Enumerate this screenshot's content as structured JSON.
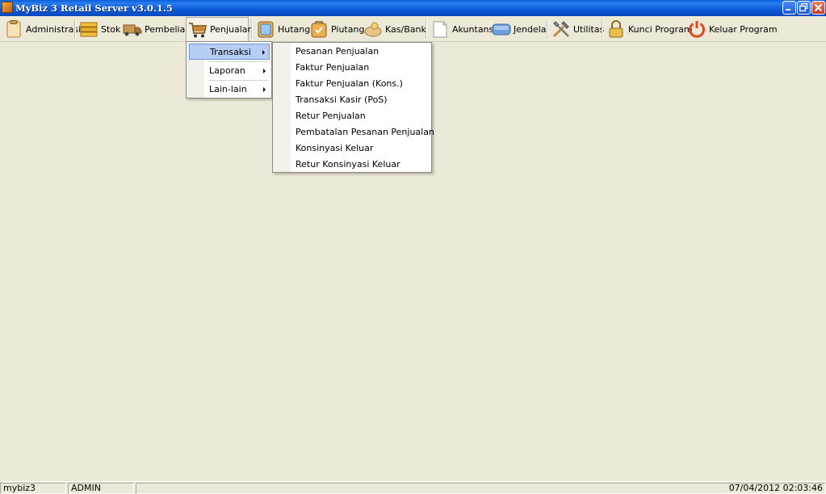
{
  "window": {
    "title": "MyBiz 3 Retail Server v3.0.1.5"
  },
  "menubar": {
    "items": [
      {
        "label": "Administrasi",
        "icon": "clipboard-icon"
      },
      {
        "label": "Stok",
        "icon": "stock-boxes-icon"
      },
      {
        "label": "Pembelian",
        "icon": "truck-icon"
      },
      {
        "label": "Penjualan",
        "icon": "shopping-cart-icon"
      },
      {
        "label": "Hutang",
        "icon": "ledger-icon"
      },
      {
        "label": "Piutang",
        "icon": "bag-icon"
      },
      {
        "label": "Kas/Bank",
        "icon": "money-hand-icon"
      },
      {
        "label": "Akuntansi",
        "icon": "document-icon"
      },
      {
        "label": "Jendela",
        "icon": "window-icon"
      },
      {
        "label": "Utilitas",
        "icon": "tools-icon"
      },
      {
        "label": "Kunci Program",
        "icon": "lock-icon"
      },
      {
        "label": "Keluar Program",
        "icon": "power-icon"
      }
    ]
  },
  "penjualan_menu": {
    "items": [
      "Transaksi",
      "Laporan",
      "Lain-lain"
    ]
  },
  "transaksi_menu": {
    "items": [
      "Pesanan Penjualan",
      "Faktur Penjualan",
      "Faktur Penjualan (Kons.)",
      "Transaksi Kasir (PoS)",
      "Retur Penjualan",
      "Pembatalan Pesanan Penjualan",
      "Konsinyasi Keluar",
      "Retur Konsinyasi Keluar"
    ]
  },
  "statusbar": {
    "database": "mybiz3",
    "user": "ADMIN",
    "datetime": "07/04/2012 02:03:46"
  },
  "colors": {
    "titlebar": "#0a5fd8",
    "background": "#ece9d8",
    "menu_highlight": "#b6cdf4",
    "menu_text": "#000000"
  }
}
